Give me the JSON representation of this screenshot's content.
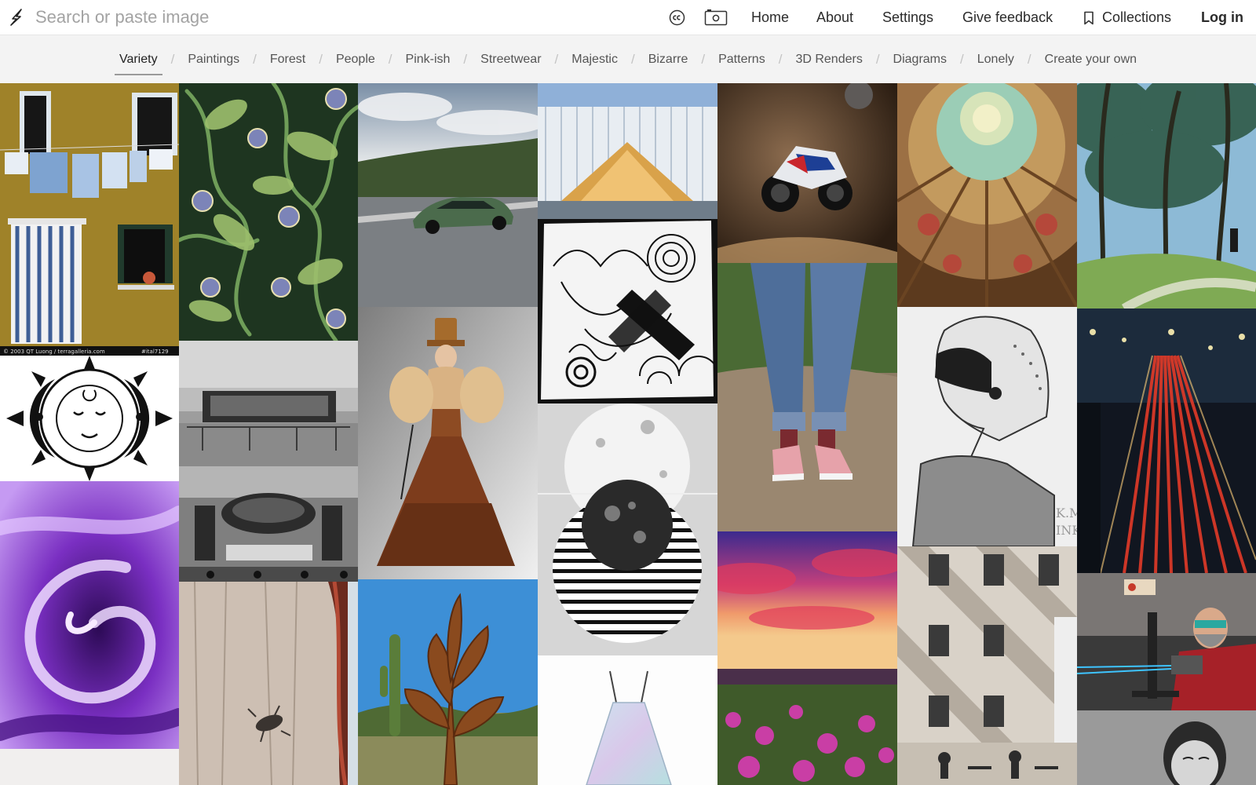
{
  "search": {
    "placeholder": "Search or paste image"
  },
  "nav": {
    "home": "Home",
    "about": "About",
    "settings": "Settings",
    "feedback": "Give feedback",
    "collections": "Collections",
    "login": "Log in"
  },
  "icons": {
    "logo": "lightning-bolt-icon",
    "license": "creative-commons-icon",
    "image_search": "camera-icon",
    "collections": "bookmark-icon"
  },
  "categories": [
    "Variety",
    "Paintings",
    "Forest",
    "People",
    "Pink-ish",
    "Streetwear",
    "Majestic",
    "Bizarre",
    "Patterns",
    "3D Renders",
    "Diagrams",
    "Lonely",
    "Create your own"
  ],
  "active_category": "Variety",
  "images": {
    "house_watermark_left": "© 2003 QT Luong / terragalleria.com",
    "house_watermark_right": "#ital7129",
    "sketch_signature_1": "K.M",
    "sketch_signature_2": "INK"
  },
  "colors": {
    "accent_underline": "#9a9a9a",
    "category_bar": "#f3f3f3"
  }
}
